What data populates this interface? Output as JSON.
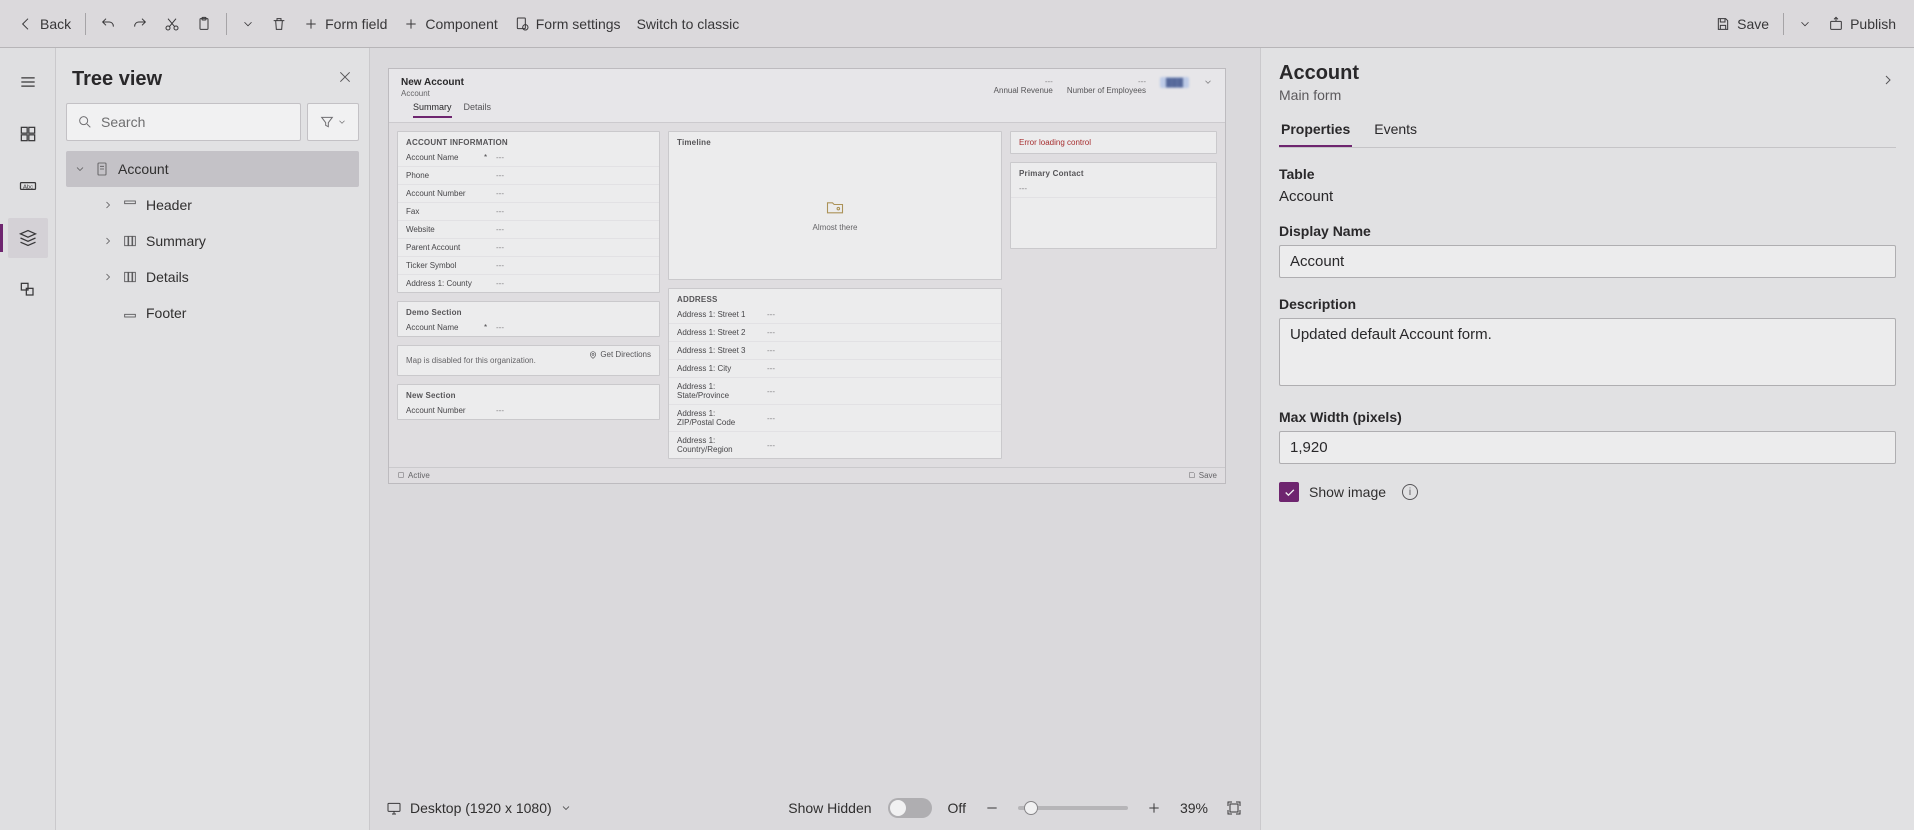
{
  "toolbar": {
    "back": "Back",
    "form_field": "Form field",
    "component": "Component",
    "form_settings": "Form settings",
    "switch_classic": "Switch to classic",
    "save": "Save",
    "publish": "Publish"
  },
  "tree": {
    "title": "Tree view",
    "search_placeholder": "Search",
    "nodes": {
      "account": "Account",
      "header": "Header",
      "summary": "Summary",
      "details": "Details",
      "footer": "Footer"
    }
  },
  "preview": {
    "title": "New Account",
    "subtitle": "Account",
    "metrics": {
      "annual_revenue": "Annual Revenue",
      "num_employees": "Number of Employees",
      "dash": "---"
    },
    "tabs": {
      "summary": "Summary",
      "details": "Details"
    },
    "sections": {
      "account_info": "ACCOUNT INFORMATION",
      "demo": "Demo Section",
      "map_note": "Map is disabled for this organization.",
      "get_directions": "Get Directions",
      "new_section": "New Section",
      "timeline": "Timeline",
      "almost_there": "Almost there",
      "address": "ADDRESS",
      "error_loading": "Error loading control",
      "primary_contact": "Primary Contact"
    },
    "fields": {
      "account_name": "Account Name",
      "phone": "Phone",
      "account_number": "Account Number",
      "fax": "Fax",
      "website": "Website",
      "parent_account": "Parent Account",
      "ticker": "Ticker Symbol",
      "addr_county": "Address 1: County",
      "addr_s1": "Address 1: Street 1",
      "addr_s2": "Address 1: Street 2",
      "addr_s3": "Address 1: Street 3",
      "addr_city": "Address 1: City",
      "addr_state": "Address 1: State/Province",
      "addr_zip": "Address 1: ZIP/Postal Code",
      "addr_country": "Address 1: Country/Region",
      "blank": "---"
    },
    "footer": {
      "active": "Active",
      "save": "Save"
    }
  },
  "statusbar": {
    "viewport": "Desktop (1920 x 1080)",
    "show_hidden": "Show Hidden",
    "off": "Off",
    "zoom": "39%"
  },
  "props": {
    "title": "Account",
    "subtitle": "Main form",
    "tabs": {
      "properties": "Properties",
      "events": "Events"
    },
    "table_label": "Table",
    "table_value": "Account",
    "display_name_label": "Display Name",
    "display_name_value": "Account",
    "description_label": "Description",
    "description_value": "Updated default Account form.",
    "maxwidth_label": "Max Width (pixels)",
    "maxwidth_value": "1,920",
    "show_image": "Show image"
  }
}
